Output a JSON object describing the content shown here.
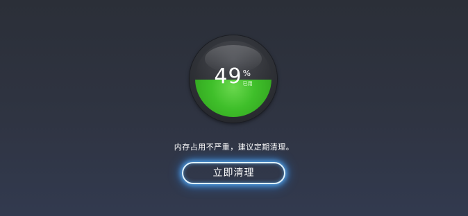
{
  "memory_gauge": {
    "value": "49",
    "percent_sign": "%",
    "unit_label": "已用",
    "fill_fraction": 0.49,
    "fill_color": "#3fbf2a"
  },
  "status": {
    "message": "内存占用不严重，建议定期清理。"
  },
  "actions": {
    "clean_now_label": "立即清理",
    "accent_glow": "#5ab4ff"
  }
}
